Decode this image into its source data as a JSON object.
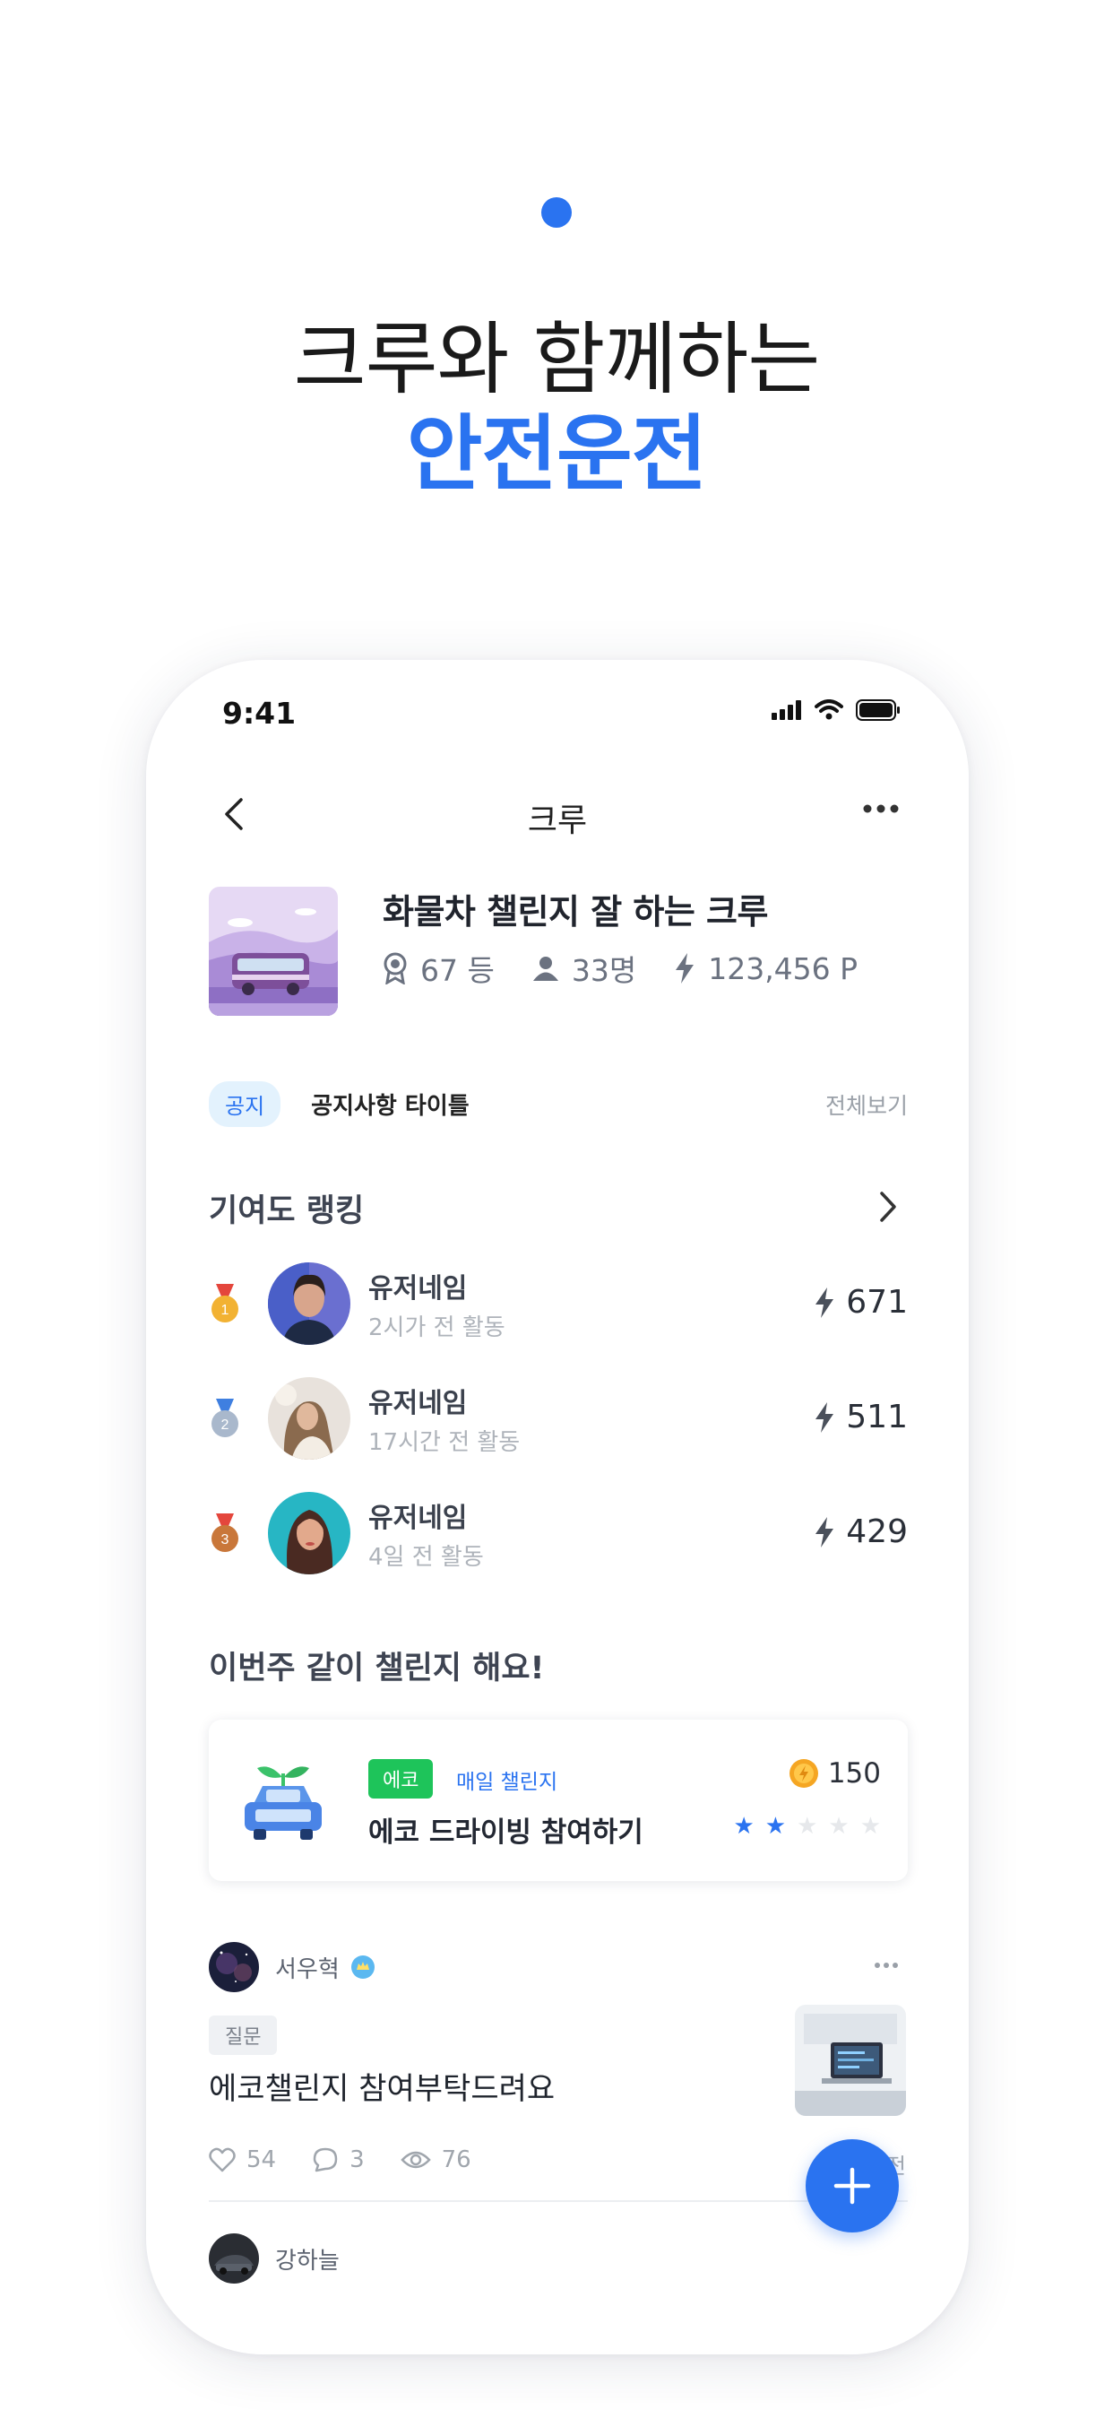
{
  "hero": {
    "line1": "크루와 함께하는",
    "line2": "안전운전",
    "accent": "#2a73f0"
  },
  "status": {
    "time": "9:41"
  },
  "nav": {
    "title": "크루",
    "back_icon": "chevron-left-icon",
    "more_icon": "more-horizontal-icon"
  },
  "crew": {
    "name": "화물차 챌린지 잘 하는 크루",
    "rank": "67 등",
    "members": "33명",
    "points": "123,456 P"
  },
  "notice": {
    "badge": "공지",
    "title": "공지사항 타이틀",
    "view_all": "전체보기"
  },
  "ranking": {
    "title": "기여도 랭킹",
    "items": [
      {
        "place": "1",
        "name": "유저네임",
        "activity": "2시가 전 활동",
        "score": "671",
        "medal_color": "#f2b233"
      },
      {
        "place": "2",
        "name": "유저네임",
        "activity": "17시간 전 활동",
        "score": "511",
        "medal_color": "#a9b8cc"
      },
      {
        "place": "3",
        "name": "유저네임",
        "activity": "4일 전 활동",
        "score": "429",
        "medal_color": "#c9773a"
      }
    ]
  },
  "challenge": {
    "section_title": "이번주 같이 챌린지 해요!",
    "badge": "에코",
    "type": "매일 챌린지",
    "title": "에코 드라이빙 참여하기",
    "coins": "150",
    "rating": 2,
    "rating_max": 5
  },
  "post": {
    "author": "서우혁",
    "tag": "질문",
    "title": "에코챌린지 참여부탁드려요",
    "likes": "54",
    "comments": "3",
    "views": "76",
    "time": "7시간 전"
  },
  "post2": {
    "author": "강하늘"
  }
}
